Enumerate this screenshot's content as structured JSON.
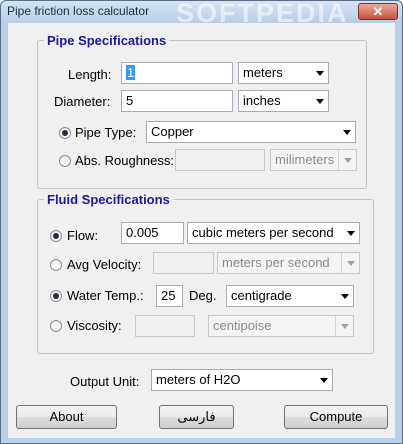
{
  "window": {
    "title": "Pipe friction loss calculator",
    "watermark": "SOFTPEDIA",
    "close_glyph": "✕"
  },
  "pipe": {
    "legend": "Pipe Specifications",
    "length_label": "Length:",
    "length_value": "1",
    "length_unit": "meters",
    "diameter_label": "Diameter:",
    "diameter_value": "5",
    "diameter_unit": "inches",
    "type_label": "Pipe Type:",
    "type_value": "Copper",
    "roughness_label": "Abs. Roughness:",
    "roughness_value": "",
    "roughness_unit": "milimeters"
  },
  "fluid": {
    "legend": "Fluid Specifications",
    "flow_label": "Flow:",
    "flow_value": "0.005",
    "flow_unit": "cubic meters per second",
    "velocity_label": "Avg Velocity:",
    "velocity_value": "",
    "velocity_unit": "meters per second",
    "temp_label": "Water Temp.:",
    "temp_value": "25",
    "temp_unit_label": "Deg.",
    "temp_unit": "centigrade",
    "viscosity_label": "Viscosity:",
    "viscosity_value": "",
    "viscosity_unit": "centipoise"
  },
  "output": {
    "label": "Output Unit:",
    "value": "meters of H2O"
  },
  "buttons": {
    "about": "About",
    "farsi": "فارسی",
    "compute": "Compute"
  }
}
